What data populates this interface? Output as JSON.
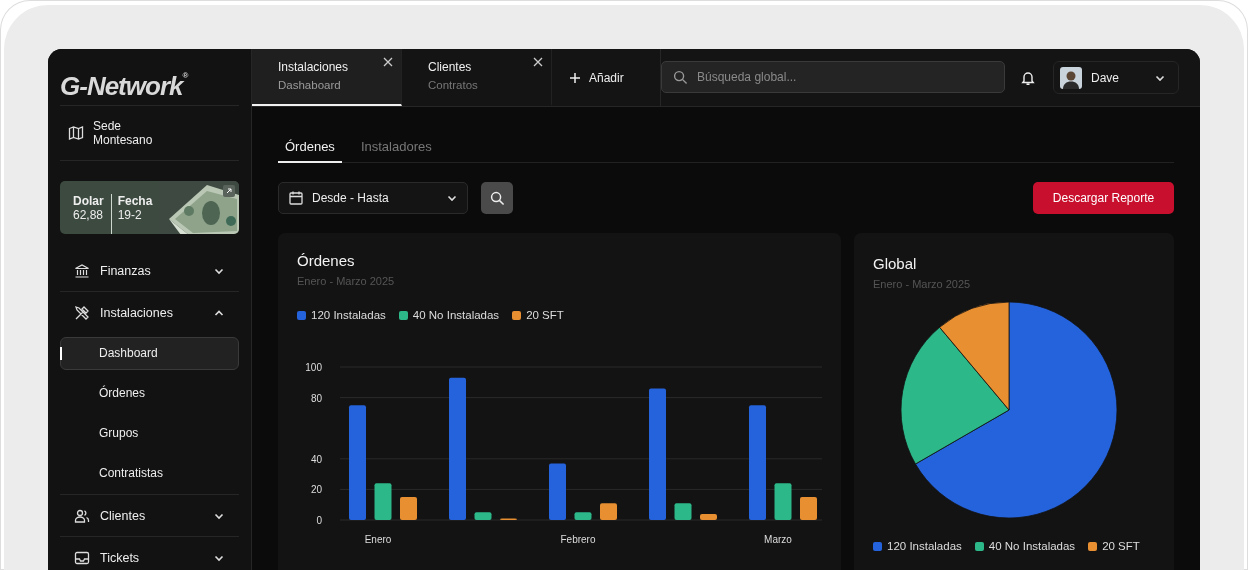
{
  "logo": {
    "name": "G-Network",
    "mark": "®"
  },
  "location": {
    "label": "Sede",
    "value": "Montesano"
  },
  "rate_card": {
    "items": [
      {
        "label": "Dolar",
        "value": "62,88"
      },
      {
        "label": "Fecha",
        "value": "19-2"
      }
    ]
  },
  "nav": [
    {
      "label": "Finanzas",
      "expanded": false
    },
    {
      "label": "Instalaciones",
      "expanded": true,
      "children": [
        {
          "label": "Dashboard",
          "selected": true
        },
        {
          "label": "Órdenes",
          "selected": false
        },
        {
          "label": "Grupos",
          "selected": false
        },
        {
          "label": "Contratistas",
          "selected": false
        }
      ]
    },
    {
      "label": "Clientes",
      "expanded": false
    },
    {
      "label": "Tickets",
      "expanded": false
    }
  ],
  "tabs": [
    {
      "title": "Instalaciones",
      "subtitle": "Dashaboard",
      "selected": true
    },
    {
      "title": "Clientes",
      "subtitle": "Contratos",
      "selected": false
    }
  ],
  "add_tab": "Añadir",
  "search": {
    "placeholder": "Búsqueda global..."
  },
  "user": {
    "name": "Dave"
  },
  "subtabs": [
    {
      "label": "Órdenes",
      "selected": true
    },
    {
      "label": "Instaladores",
      "selected": false
    }
  ],
  "date_filter": "Desde - Hasta",
  "download": "Descargar Reporte",
  "orders": {
    "title": "Órdenes",
    "subtitle": "Enero - Marzo 2025",
    "chart_data": {
      "type": "bar",
      "categories": [
        "Enero",
        null,
        "Febrero",
        null,
        "Marzo"
      ],
      "ylim": [
        0,
        100
      ],
      "grid": true,
      "yticks": [
        0,
        20,
        40,
        80,
        100
      ],
      "series": [
        {
          "name": "120 Instaladas",
          "color": "#2563dc",
          "values": [
            75,
            93,
            37,
            86,
            75
          ]
        },
        {
          "name": "40 No Instaladas",
          "color": "#2db88a",
          "values": [
            24,
            5,
            5,
            11,
            24
          ]
        },
        {
          "name": "20 SFT",
          "color": "#e88f32",
          "values": [
            15,
            1,
            11,
            4,
            15
          ]
        }
      ]
    }
  },
  "global": {
    "title": "Global",
    "subtitle": "Enero - Marzo 2025",
    "chart_data": {
      "type": "pie",
      "categories": [
        "120 Instaladas",
        "40 No Instaladas",
        "20 SFT"
      ],
      "values": [
        120,
        40,
        20
      ],
      "colors": [
        "#2563dc",
        "#2db88a",
        "#e88f32"
      ]
    }
  }
}
